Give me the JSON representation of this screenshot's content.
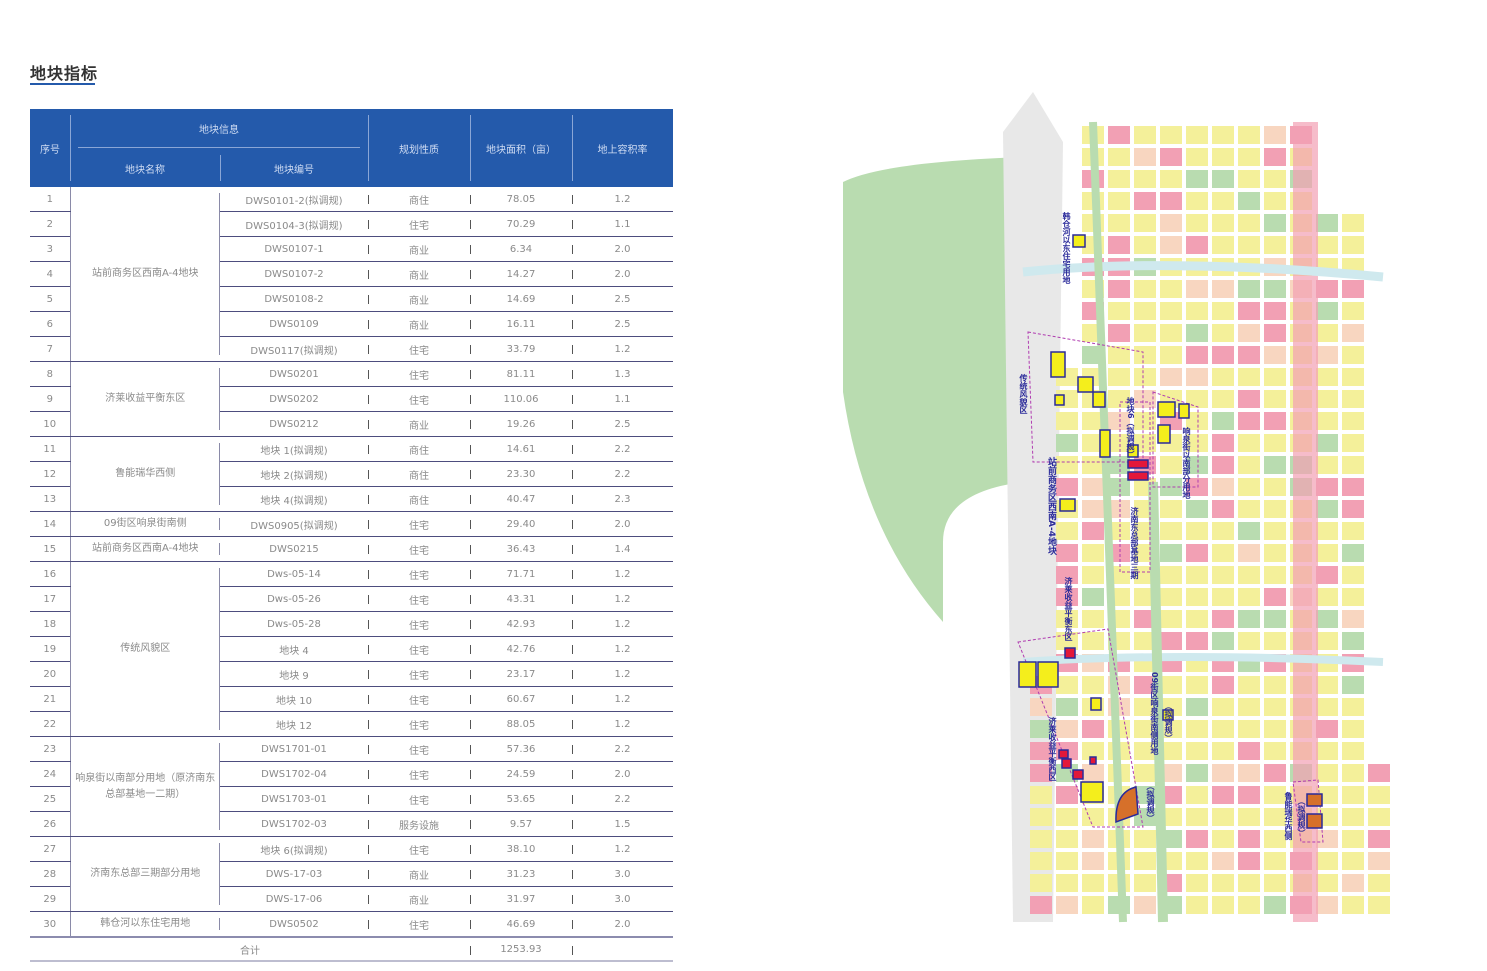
{
  "page_title": "地块指标",
  "table": {
    "headers": {
      "seq": "序号",
      "info": "地块信息",
      "name": "地块名称",
      "code": "地块编号",
      "nature": "规划性质",
      "area": "地块面积（亩）",
      "far": "地上容积率"
    },
    "groups": [
      {
        "name": "站前商务区西南A-4地块",
        "span": 7
      },
      {
        "name": "济莱收益平衡东区",
        "span": 3
      },
      {
        "name": "鲁能瑞华西侧",
        "span": 3
      },
      {
        "name": "09街区响泉街南侧",
        "span": 1
      },
      {
        "name": "站前商务区西南A-4地块",
        "span": 1
      },
      {
        "name": "传统风貌区",
        "span": 7
      },
      {
        "name": "响泉街以南部分用地（原济南东总部基地一二期）",
        "span": 4
      },
      {
        "name": "济南东总部三期部分用地",
        "span": 3
      },
      {
        "name": "韩仓河以东住宅用地",
        "span": 1
      }
    ],
    "rows": [
      {
        "seq": "1",
        "code": "DWS0101-2(拟调规)",
        "nature": "商住",
        "area": "78.05",
        "far": "1.2"
      },
      {
        "seq": "2",
        "code": "DWS0104-3(拟调规)",
        "nature": "住宅",
        "area": "70.29",
        "far": "1.1"
      },
      {
        "seq": "3",
        "code": "DWS0107-1",
        "nature": "商业",
        "area": "6.34",
        "far": "2.0"
      },
      {
        "seq": "4",
        "code": "DWS0107-2",
        "nature": "商业",
        "area": "14.27",
        "far": "2.0"
      },
      {
        "seq": "5",
        "code": "DWS0108-2",
        "nature": "商业",
        "area": "14.69",
        "far": "2.5"
      },
      {
        "seq": "6",
        "code": "DWS0109",
        "nature": "商业",
        "area": "16.11",
        "far": "2.5"
      },
      {
        "seq": "7",
        "code": "DWS0117(拟调规)",
        "nature": "住宅",
        "area": "33.79",
        "far": "1.2"
      },
      {
        "seq": "8",
        "code": "DWS0201",
        "nature": "住宅",
        "area": "81.11",
        "far": "1.3"
      },
      {
        "seq": "9",
        "code": "DWS0202",
        "nature": "住宅",
        "area": "110.06",
        "far": "1.1"
      },
      {
        "seq": "10",
        "code": "DWS0212",
        "nature": "商业",
        "area": "19.26",
        "far": "2.5"
      },
      {
        "seq": "11",
        "code": "地块 1(拟调规)",
        "nature": "商住",
        "area": "14.61",
        "far": "2.2"
      },
      {
        "seq": "12",
        "code": "地块 2(拟调规)",
        "nature": "商住",
        "area": "23.30",
        "far": "2.2"
      },
      {
        "seq": "13",
        "code": "地块 4(拟调规)",
        "nature": "商住",
        "area": "40.47",
        "far": "2.3"
      },
      {
        "seq": "14",
        "code": "DWS0905(拟调规)",
        "nature": "住宅",
        "area": "29.40",
        "far": "2.0"
      },
      {
        "seq": "15",
        "code": "DWS0215",
        "nature": "住宅",
        "area": "36.43",
        "far": "1.4"
      },
      {
        "seq": "16",
        "code": "Dws-05-14",
        "nature": "住宅",
        "area": "71.71",
        "far": "1.2"
      },
      {
        "seq": "17",
        "code": "Dws-05-26",
        "nature": "住宅",
        "area": "43.31",
        "far": "1.2"
      },
      {
        "seq": "18",
        "code": "Dws-05-28",
        "nature": "住宅",
        "area": "42.93",
        "far": "1.2"
      },
      {
        "seq": "19",
        "code": "地块 4",
        "nature": "住宅",
        "area": "42.76",
        "far": "1.2"
      },
      {
        "seq": "20",
        "code": "地块 9",
        "nature": "住宅",
        "area": "23.17",
        "far": "1.2"
      },
      {
        "seq": "21",
        "code": "地块 10",
        "nature": "住宅",
        "area": "60.67",
        "far": "1.2"
      },
      {
        "seq": "22",
        "code": "地块 12",
        "nature": "住宅",
        "area": "88.05",
        "far": "1.2"
      },
      {
        "seq": "23",
        "code": "DWS1701-01",
        "nature": "住宅",
        "area": "57.36",
        "far": "2.2"
      },
      {
        "seq": "24",
        "code": "DWS1702-04",
        "nature": "住宅",
        "area": "24.59",
        "far": "2.0"
      },
      {
        "seq": "25",
        "code": "DWS1703-01",
        "nature": "住宅",
        "area": "53.65",
        "far": "2.2"
      },
      {
        "seq": "26",
        "code": "DWS1702-03",
        "nature": "服务设施",
        "area": "9.57",
        "far": "1.5"
      },
      {
        "seq": "27",
        "code": "地块 6(拟调规)",
        "nature": "住宅",
        "area": "38.10",
        "far": "1.2"
      },
      {
        "seq": "28",
        "code": "DWS-17-03",
        "nature": "商业",
        "area": "31.23",
        "far": "3.0"
      },
      {
        "seq": "29",
        "code": "DWS-17-06",
        "nature": "商业",
        "area": "31.97",
        "far": "3.0"
      },
      {
        "seq": "30",
        "code": "DWS0502",
        "nature": "住宅",
        "area": "46.69",
        "far": "2.0"
      }
    ],
    "total": {
      "label": "合计",
      "area": "1253.93"
    }
  },
  "map": {
    "labels": [
      "韩仓河以东住宅用地",
      "传统风貌区",
      "站前商务区西南A-4地块",
      "地块6（拟调规）",
      "济南东总部基地三期",
      "响泉街以南部分用地",
      "济莱收益平衡东区",
      "09街区响泉街南侧用地",
      "（拟调规）",
      "济莱收益平衡西区",
      "（拟调规）",
      "鲁能瑞华西侧",
      "（拟调规）"
    ],
    "colors": {
      "residential": "#f4f09a",
      "commercial": "#f2a0b4",
      "green": "#b9dcb0",
      "water": "#cfe9ee",
      "road": "#ffffff",
      "highlight": "#f4ee1c",
      "highlight_red": "#e3183a",
      "highlight_orange": "#d6702a",
      "outline": "#2a2a9a",
      "boundary": "#b03cb0"
    }
  }
}
